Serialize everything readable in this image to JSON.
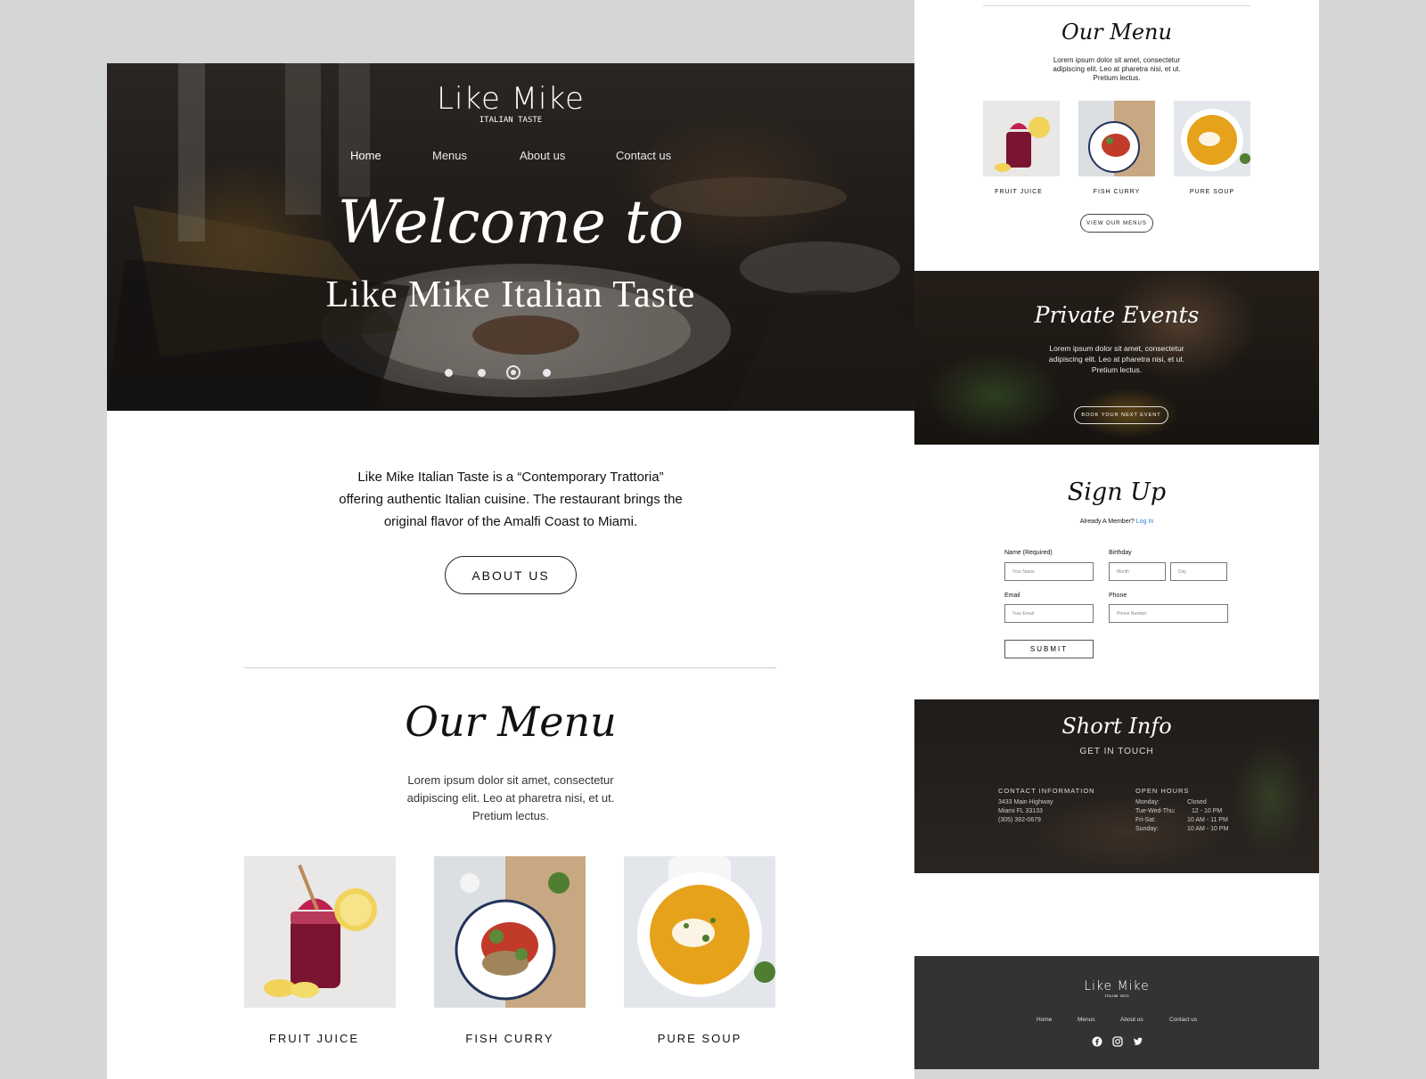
{
  "brand": {
    "name": "Like Mike",
    "tagline": "ITALIAN TASTE"
  },
  "nav": {
    "items": [
      "Home",
      "Menus",
      "About us",
      "Contact us"
    ],
    "active": "Home"
  },
  "hero": {
    "welcome": "Welcome to",
    "title": "Like Mike Italian Taste",
    "slides": 4,
    "active_slide": 3
  },
  "intro": {
    "line1": "Like Mike Italian Taste is a “Contemporary Trattoria”",
    "line2": "offering authentic Italian cuisine. The restaurant brings the",
    "line3": "original flavor of the  Amalfi Coast to Miami.",
    "button": "ABOUT US"
  },
  "menu": {
    "title": "Our Menu",
    "line1": "Lorem ipsum dolor sit amet, consectetur",
    "line2": "adipiscing elit. Leo at pharetra nisi, et ut.",
    "line3": "Pretium lectus.",
    "items": [
      "FRUIT JUICE",
      "FISH CURRY",
      "PURE SOUP"
    ],
    "view_button": "VIEW OUR MENUS"
  },
  "events": {
    "title": "Private Events",
    "line1": "Lorem ipsum dolor sit amet, consectetur",
    "line2": "adipiscing elit. Leo at pharetra nisi, et ut.",
    "line3": "Pretium lectus.",
    "button": "BOOK YOUR NEXT EVENT"
  },
  "signup": {
    "title": "Sign Up",
    "member_text": "Already A Member?",
    "login": "Log In",
    "name_label": "Name (Required)",
    "name_placeholder": "Your Name",
    "birthday_label": "Birthday",
    "month_placeholder": "Month",
    "day_placeholder": "Day",
    "email_label": "Email",
    "email_placeholder": "Your Email",
    "phone_label": "Phone",
    "phone_placeholder": "Phone Number",
    "submit": "SUBMIT"
  },
  "info": {
    "title": "Short Info",
    "subtitle": "GET IN TOUCH",
    "contact_heading": "CONTACT INFORMATION",
    "address1": "3433 Main Highway",
    "address2": "Miami FL 33133",
    "phone": "(305) 392-0679",
    "hours_heading": "OPEN HOURS",
    "hours": [
      {
        "day": "Monday:",
        "time": "Closed"
      },
      {
        "day": "Tue-Wed-Thu:",
        "time": "12 - 10 PM"
      },
      {
        "day": "Fri-Sat:",
        "time": "10 AM - 11 PM"
      },
      {
        "day": "Sunday:",
        "time": "10 AM - 10 PM"
      }
    ]
  },
  "footer": {
    "brand": "Like Mike",
    "tagline": "ITALIAN TASTE",
    "nav": [
      "Home",
      "Menus",
      "About us",
      "Contact us"
    ]
  },
  "colors": {
    "link": "#2f7fd6",
    "footer_bg": "#333333",
    "page_bg": "#d6d6d6"
  }
}
